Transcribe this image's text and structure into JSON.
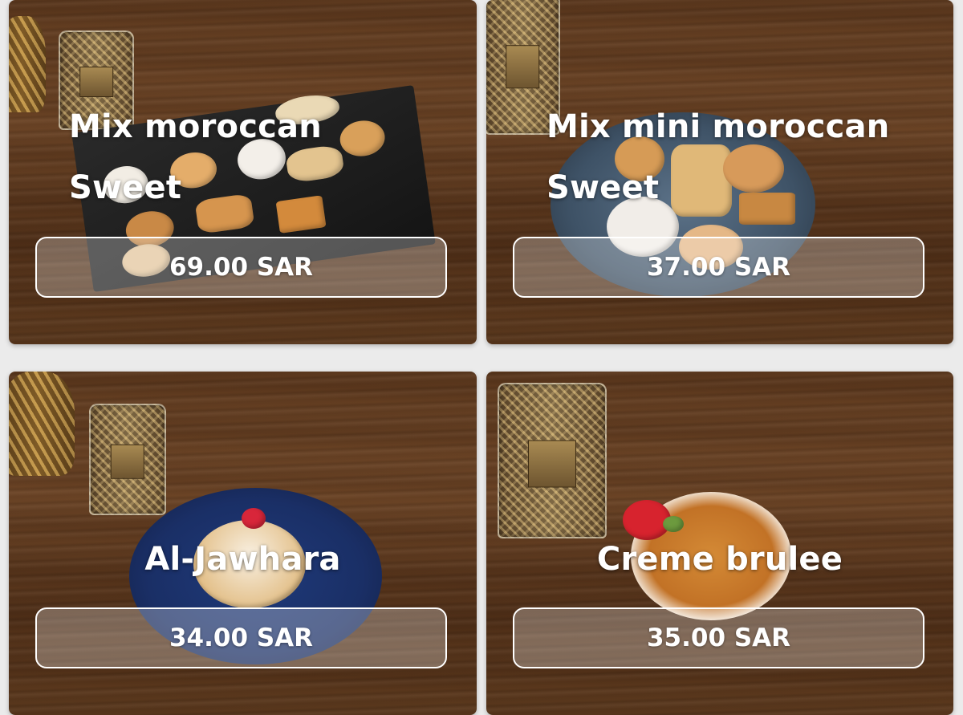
{
  "products": [
    {
      "name": "Mix moroccan Sweet",
      "price": "69.00 SAR"
    },
    {
      "name": "Mix mini moroccan Sweet",
      "price": "37.00 SAR"
    },
    {
      "name": "Al-Jawhara",
      "price": "34.00 SAR"
    },
    {
      "name": "Creme brulee",
      "price": "35.00 SAR"
    }
  ],
  "colors": {
    "background": "#ebebeb",
    "text": "#ffffff",
    "price_border": "#ffffff"
  }
}
